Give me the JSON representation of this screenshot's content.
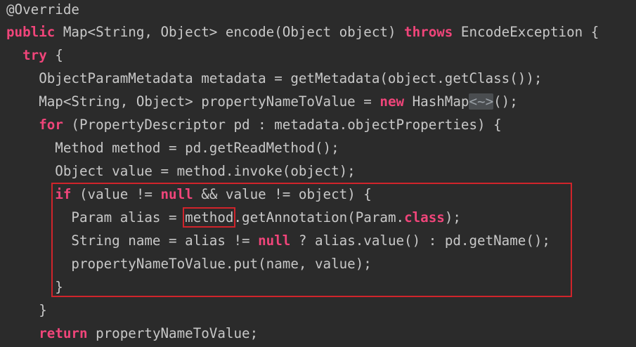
{
  "code": {
    "lines": [
      "@Override",
      "public Map<String, Object> encode(Object object) throws EncodeException {",
      "  try {",
      "    ObjectParamMetadata metadata = getMetadata(object.getClass());",
      "    Map<String, Object> propertyNameToValue = new HashMap<~>();",
      "    for (PropertyDescriptor pd : metadata.objectProperties) {",
      "      Method method = pd.getReadMethod();",
      "      Object value = method.invoke(object);",
      "      if (value != null && value != object) {",
      "        Param alias = method.getAnnotation(Param.class);",
      "        String name = alias != null ? alias.value() : pd.getName();",
      "        propertyNameToValue.put(name, value);",
      "      }",
      "    }",
      "    return propertyNameToValue;"
    ],
    "keywords": [
      "public",
      "throws",
      "try",
      "new",
      "for",
      "if",
      "null",
      "class",
      "return"
    ],
    "highlighted_word": "method",
    "folded_diamond": "<~>"
  },
  "colors": {
    "background": "#2b2b2b",
    "text": "#c8c8c8",
    "keyword": "#f0457a",
    "highlight_border": "#d0242b",
    "fold_background": "#4a4d50"
  }
}
